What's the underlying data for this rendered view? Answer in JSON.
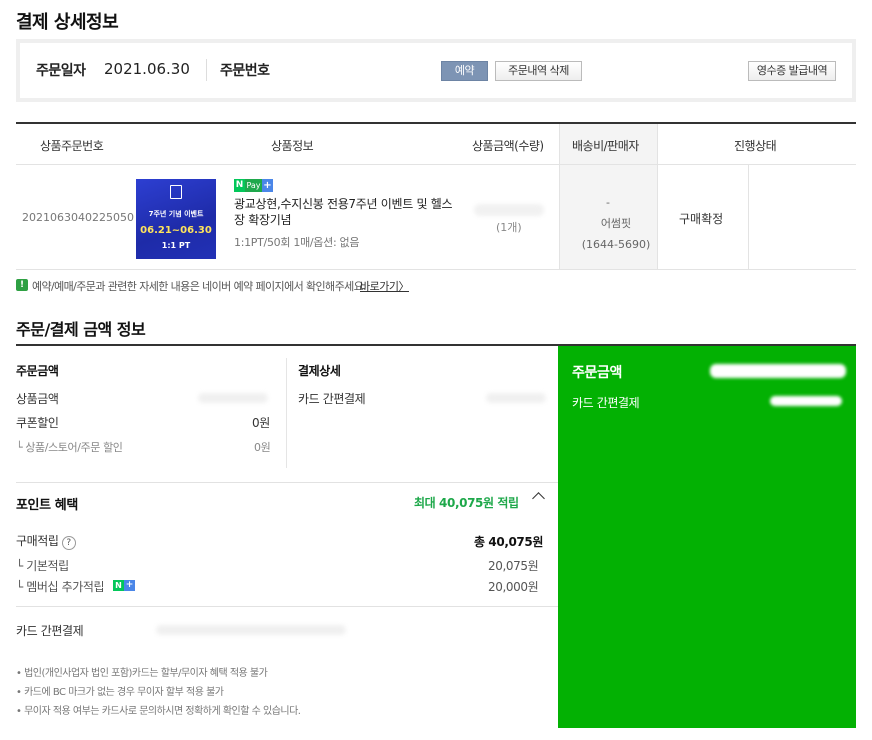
{
  "page": {
    "title": "결제 상세정보"
  },
  "order": {
    "date_label": "주문일자",
    "date_value": "2021.06.30",
    "number_label": "주문번호",
    "reserve_button": "예약",
    "delete_button": "주문내역 삭제",
    "receipt_button": "영수증 발급내역"
  },
  "table": {
    "headers": [
      "상품주문번호",
      "상품정보",
      "상품금액(수량)",
      "배송비/판매자",
      "진행상태"
    ],
    "row": {
      "product_no": "2021063040225050",
      "thumb_line1": "7주년 기념 이벤트",
      "thumb_line2": "06.21~06.30",
      "thumb_line3": "1:1 PT",
      "badge_n": "N",
      "badge_pay": "Pay",
      "badge_plus": "+",
      "name": "광교상현,수지신봉 전용7주년 이벤트 및 헬스장 확장기념",
      "option": "1:1PT/50회 1매/옵션: 없음",
      "qty": "(1개)",
      "shipping": "-",
      "seller": "어썸핏",
      "seller_tel": "(1644-5690)",
      "status": "구매확정"
    }
  },
  "notice": {
    "icon": "!",
    "text": "예약/예매/주문과 관련한 자세한 내용은 네이버 예약 페이지에서 확인해주세요.",
    "link": "바로가기〉"
  },
  "amount_section": {
    "title": "주문/결제 금액 정보",
    "order_amount_label": "주문금액",
    "product_amount_label": "상품금액",
    "coupon_label": "쿠폰할인",
    "coupon_value": "0원",
    "store_discount_label": "└ 상품/스토어/주문 할인",
    "store_discount_value": "0원",
    "payment_detail_label": "결제상세",
    "card_easy_label": "카드 간편결제",
    "point_title": "포인트 혜택",
    "point_max": "최대 40,075원 적립",
    "purchase_point_label": "구매적립",
    "purchase_point_value": "총 40,075원",
    "basic_point_label": "└ 기본적립",
    "basic_point_value": "20,075원",
    "member_point_label": "└ 멤버십 추가적립",
    "member_point_value": "20,000원",
    "card_easy_label2": "카드 간편결제",
    "notes": [
      "• 법인(개인사업자 법인 포함)카드는 할부/무이자 혜택 적용 불가",
      "• 카드에 BC 마크가 없는 경우 무이자 할부 적용 불가",
      "• 무이자 적용 여부는 카드사로 문의하시면 정확하게 확인할 수 있습니다."
    ],
    "question_icon": "?"
  },
  "summary_panel": {
    "title": "주문금액",
    "card_easy_label": "카드 간편결제"
  },
  "colors": {
    "summary_green": "#03b103",
    "reserve_button_bg": "#7d94b4",
    "point_green": "#1ea84a"
  }
}
